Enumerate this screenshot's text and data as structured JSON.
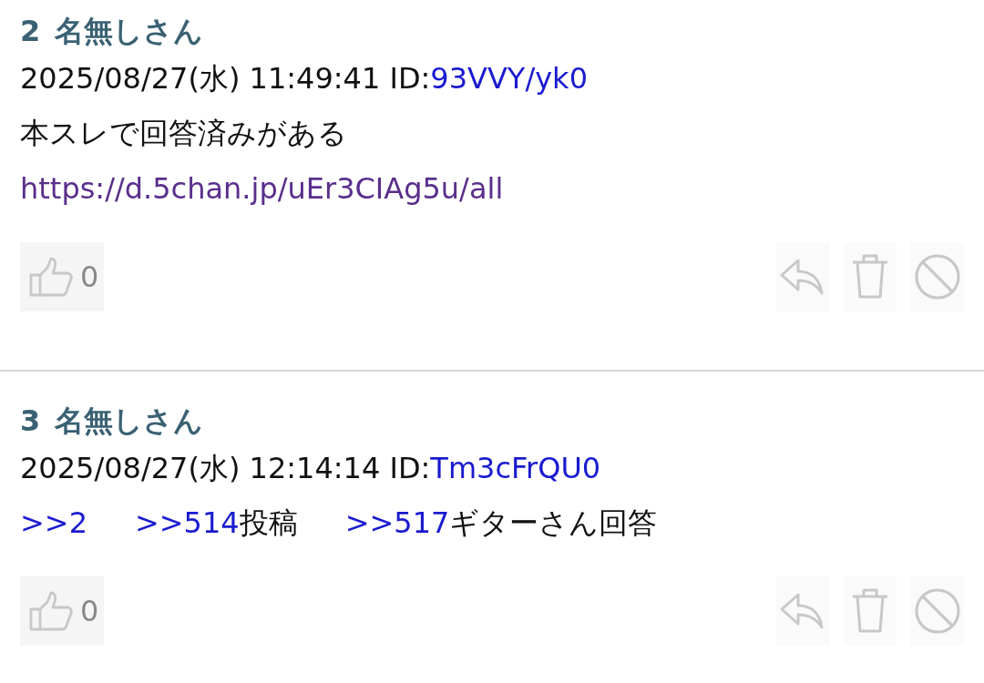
{
  "posts": [
    {
      "number": "2",
      "name": "名無しさん",
      "date": "2025/08/27(水) 11:49:41",
      "id_label": "ID:",
      "id": "93VVY/yk0",
      "body": [
        [
          [
            {
              "kind": "text",
              "text": "本スレで回答済みがある"
            }
          ]
        ],
        [
          [
            {
              "kind": "url",
              "text": "https://d.5chan.jp/uEr3CIAg5u/all"
            }
          ]
        ]
      ],
      "likes": "0"
    },
    {
      "number": "3",
      "name": "名無しさん",
      "date": "2025/08/27(水) 12:14:14",
      "id_label": "ID:",
      "id": "Tm3cFrQU0",
      "body": [
        [
          [
            {
              "kind": "anchor",
              "text": ">>2"
            }
          ],
          [
            {
              "kind": "anchor",
              "text": ">>514"
            },
            {
              "kind": "text",
              "text": "投稿"
            }
          ],
          [
            {
              "kind": "anchor",
              "text": ">>517"
            },
            {
              "kind": "text",
              "text": "ギターさん回答"
            }
          ]
        ]
      ],
      "likes": "0"
    }
  ]
}
